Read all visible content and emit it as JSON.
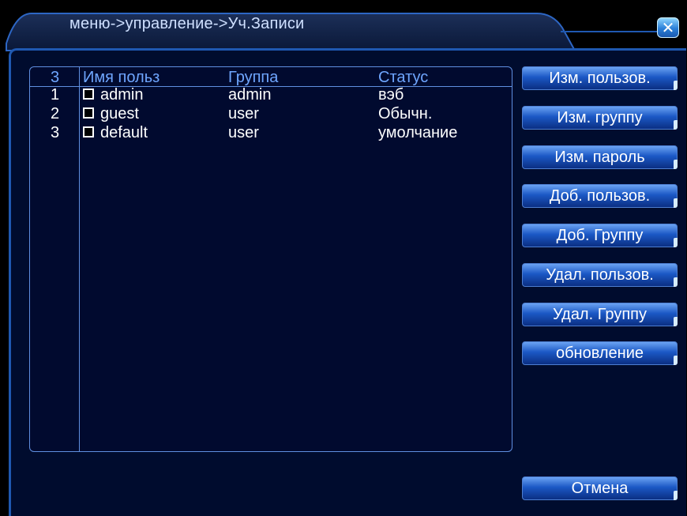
{
  "window": {
    "breadcrumb": "меню->управление->Уч.Записи",
    "close_glyph": "✕",
    "close_icon": "close-icon"
  },
  "table": {
    "headers": {
      "index": "3",
      "username": "Имя польз",
      "group": "Группа",
      "status": "Статус"
    },
    "rows": [
      {
        "index": "1",
        "username": "admin",
        "group": "admin",
        "status": "вэб",
        "checked": false
      },
      {
        "index": "2",
        "username": "guest",
        "group": "user",
        "status": "Обычн.",
        "checked": false
      },
      {
        "index": "3",
        "username": "default",
        "group": "user",
        "status": "умолчание",
        "checked": false
      }
    ]
  },
  "buttons": {
    "modify_user": "Изм. пользов.",
    "modify_group": "Изм. группу",
    "modify_password": "Изм. пароль",
    "add_user": "Доб. пользов.",
    "add_group": "Доб. Группу",
    "delete_user": "Удал. пользов.",
    "delete_group": "Удал. Группу",
    "refresh": "обновление",
    "cancel": "Отмена"
  },
  "colors": {
    "accent": "#1f58b0",
    "header_text": "#6fa6ff",
    "panel_bg": "#000c2e"
  }
}
